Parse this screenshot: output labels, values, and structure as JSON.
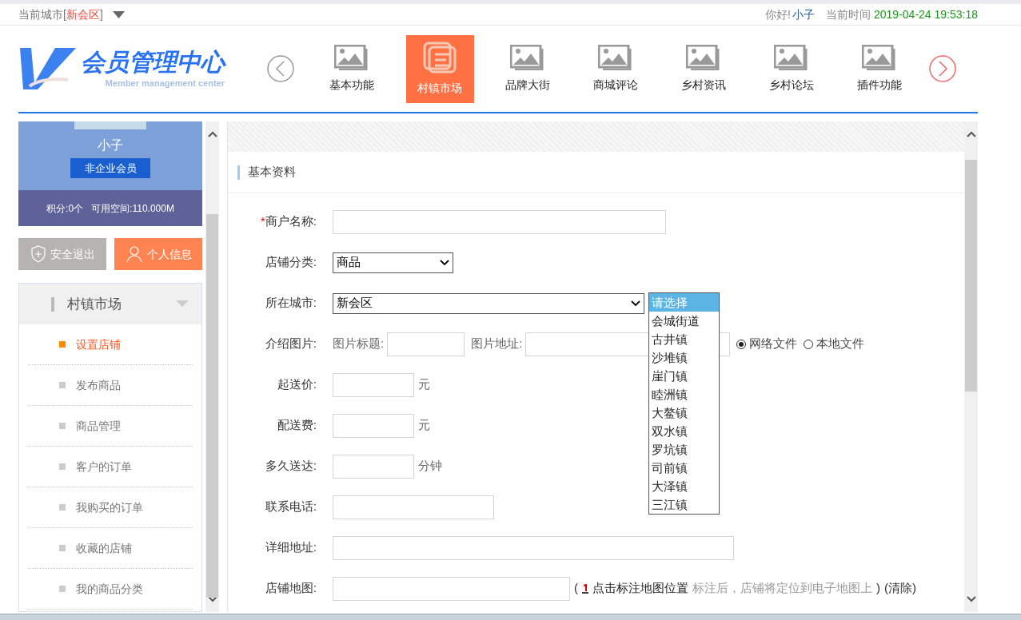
{
  "topbar": {
    "city_label": "当前城市[",
    "city": "新会区",
    "city_close": "]",
    "greeting": "你好!",
    "user": "小子",
    "time_label": "当前时间",
    "time": "2019-04-24 19:53:18"
  },
  "logo": {
    "title": "会员管理中心",
    "subtitle": "Member management center"
  },
  "nav": [
    {
      "label": "基本功能",
      "selected": false
    },
    {
      "label": "村镇市场",
      "selected": true
    },
    {
      "label": "品牌大街",
      "selected": false
    },
    {
      "label": "商城评论",
      "selected": false
    },
    {
      "label": "乡村资讯",
      "selected": false
    },
    {
      "label": "乡村论坛",
      "selected": false
    },
    {
      "label": "插件功能",
      "selected": false
    }
  ],
  "profile": {
    "name": "小子",
    "badge": "非企业会员",
    "points": "积分:0个",
    "space": "可用空间:110.000M"
  },
  "actions": [
    {
      "kind": "logout",
      "label": "安全退出"
    },
    {
      "kind": "profile",
      "label": "个人信息"
    }
  ],
  "menu": {
    "title": "村镇市场",
    "expanded": true,
    "items": [
      {
        "label": "设置店铺",
        "selected": true
      },
      {
        "label": "发布商品",
        "selected": false
      },
      {
        "label": "商品管理",
        "selected": false
      },
      {
        "label": "客户的订单",
        "selected": false
      },
      {
        "label": "我购买的订单",
        "selected": false
      },
      {
        "label": "收藏的店铺",
        "selected": false
      },
      {
        "label": "我的商品分类",
        "selected": false
      }
    ]
  },
  "form": {
    "section_title": "基本资料",
    "required_mark": "*",
    "fields": [
      {
        "kind": "name",
        "label": "商户名称:",
        "required": true
      },
      {
        "kind": "select",
        "label": "店铺分类:",
        "required": false,
        "value": "商品"
      },
      {
        "kind": "city",
        "label": "所在城市:",
        "required": false,
        "value": "新会区",
        "options": [
          {
            "label": "请选择",
            "selected": true
          },
          {
            "label": "会城街道",
            "selected": false
          },
          {
            "label": "古井镇",
            "selected": false
          },
          {
            "label": "沙堆镇",
            "selected": false
          },
          {
            "label": "崖门镇",
            "selected": false
          },
          {
            "label": "睦洲镇",
            "selected": false
          },
          {
            "label": "大鳌镇",
            "selected": false
          },
          {
            "label": "双水镇",
            "selected": false
          },
          {
            "label": "罗坑镇",
            "selected": false
          },
          {
            "label": "司前镇",
            "selected": false
          },
          {
            "label": "大泽镇",
            "selected": false
          },
          {
            "label": "三江镇",
            "selected": false
          }
        ]
      },
      {
        "kind": "image",
        "label": "介绍图片:",
        "required": false,
        "title_label": "图片标题:",
        "url_label": "图片地址:",
        "radios": [
          {
            "label": "网络文件",
            "selected": true
          },
          {
            "label": "本地文件",
            "selected": false
          }
        ]
      },
      {
        "kind": "amount",
        "label": "起送价:",
        "required": false,
        "unit": "元"
      },
      {
        "kind": "amount",
        "label": "配送费:",
        "required": false,
        "unit": "元"
      },
      {
        "kind": "amount",
        "label": "多久送达:",
        "required": false,
        "unit": "分钟"
      },
      {
        "kind": "phone",
        "label": "联系电话:",
        "required": false
      },
      {
        "kind": "address",
        "label": "详细地址:",
        "required": false
      },
      {
        "kind": "map",
        "label": "店铺地图:",
        "required": false,
        "prefix": "(",
        "link": "点击标注地图位置",
        "hint": "标注后，店铺将定位到电子地图上",
        "suffix": ")",
        "clear": "(清除)"
      }
    ]
  }
}
